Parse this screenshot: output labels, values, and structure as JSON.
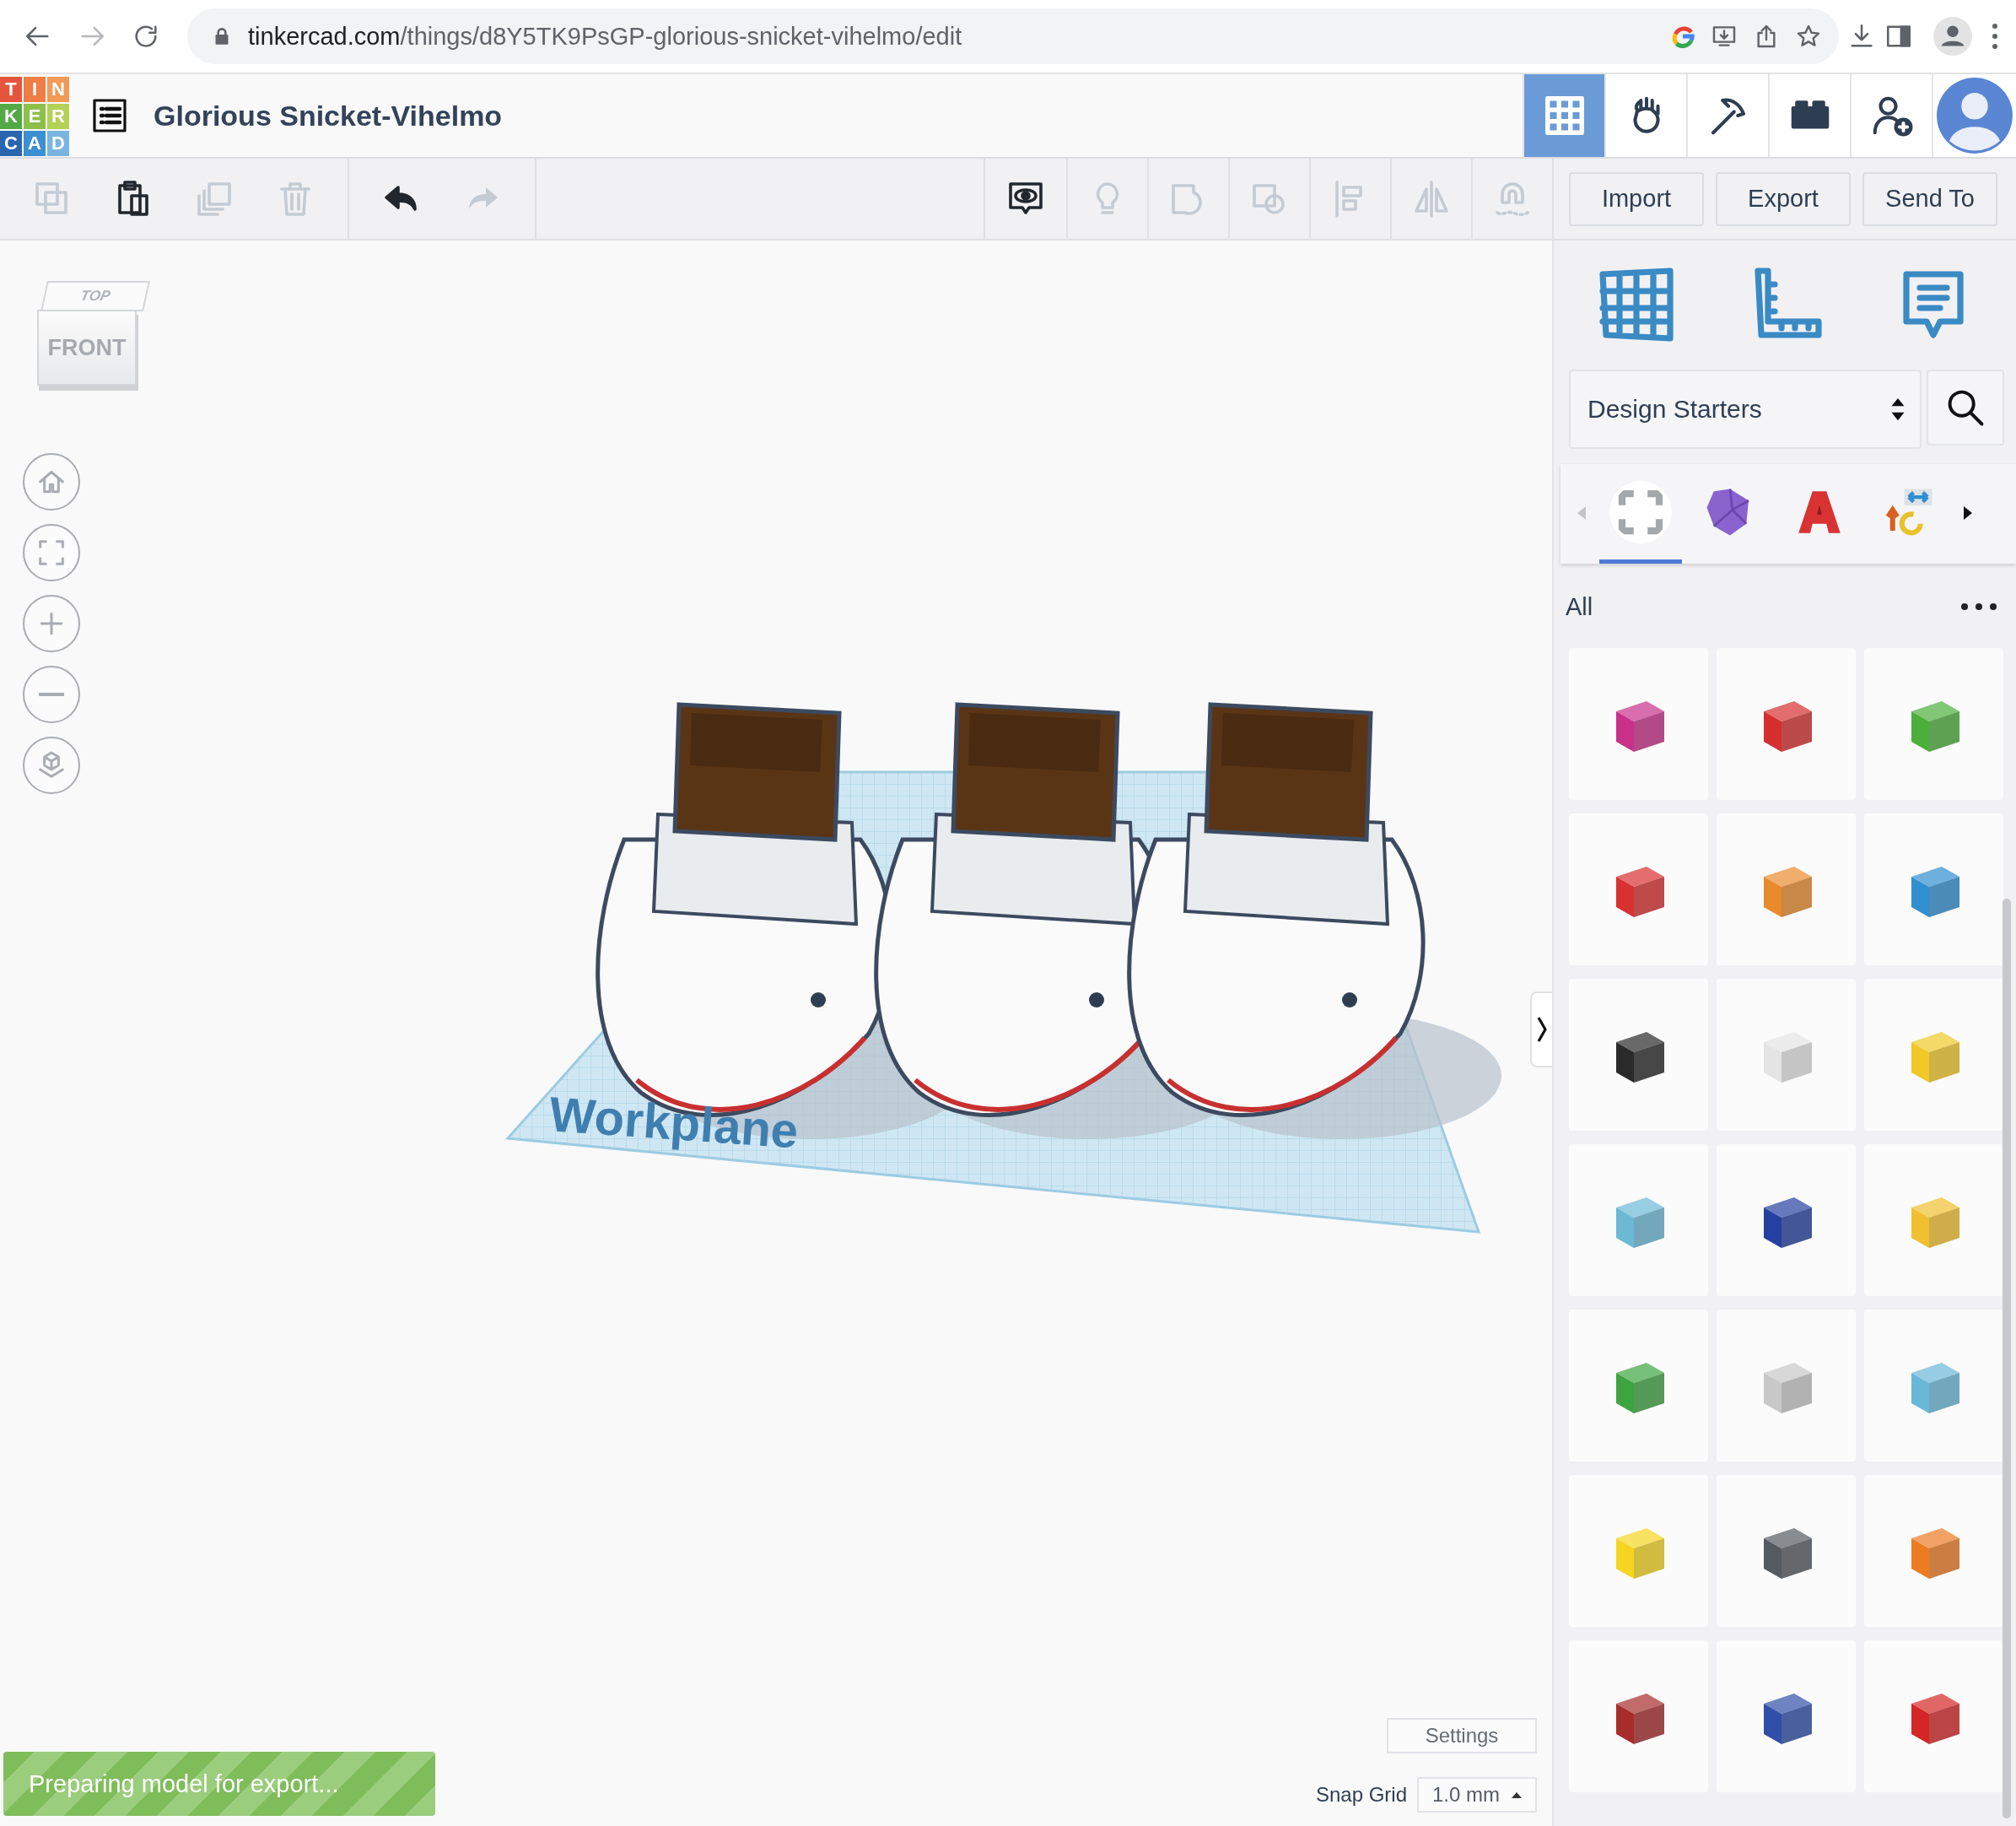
{
  "browser": {
    "url_host": "tinkercad.com",
    "url_path": "/things/d8Y5TK9PsGP-glorious-snicket-vihelmo/edit"
  },
  "header": {
    "logo": [
      {
        "letter": "T",
        "color": "#e5553d"
      },
      {
        "letter": "I",
        "color": "#ef7d45"
      },
      {
        "letter": "N",
        "color": "#f29a57"
      },
      {
        "letter": "K",
        "color": "#53a945"
      },
      {
        "letter": "E",
        "color": "#8cc04a"
      },
      {
        "letter": "R",
        "color": "#b2d155"
      },
      {
        "letter": "C",
        "color": "#2a66b0"
      },
      {
        "letter": "A",
        "color": "#3c8fd0"
      },
      {
        "letter": "D",
        "color": "#79b5e2"
      }
    ],
    "title": "Glorious Snicket-Vihelmo",
    "views": [
      {
        "kind": "grid",
        "selected": true
      },
      {
        "kind": "hand",
        "selected": false
      },
      {
        "kind": "pickaxe",
        "selected": false
      },
      {
        "kind": "brick",
        "selected": false
      },
      {
        "kind": "adduser",
        "selected": false
      }
    ]
  },
  "toolbar": {
    "edit_tools": [
      {
        "kind": "copy",
        "disabled": true
      },
      {
        "kind": "paste",
        "disabled": false
      },
      {
        "kind": "duplicate",
        "disabled": true
      },
      {
        "kind": "trash",
        "disabled": true
      }
    ],
    "history_tools": [
      {
        "kind": "undo",
        "disabled": false
      },
      {
        "kind": "redo",
        "disabled": true
      }
    ],
    "view_tools": [
      {
        "kind": "notes",
        "disabled": false
      },
      {
        "kind": "bulb",
        "disabled": true
      },
      {
        "kind": "group",
        "disabled": true
      },
      {
        "kind": "ungroup",
        "disabled": true
      },
      {
        "kind": "align",
        "disabled": true
      },
      {
        "kind": "mirror",
        "disabled": true
      },
      {
        "kind": "magnet",
        "disabled": true
      }
    ],
    "buttons": [
      "Import",
      "Export",
      "Send To"
    ]
  },
  "view_cube": {
    "top": "TOP",
    "front": "FRONT"
  },
  "nav_controls": [
    {
      "kind": "home"
    },
    {
      "kind": "fit"
    },
    {
      "kind": "zoomin"
    },
    {
      "kind": "zoomout"
    },
    {
      "kind": "ortho"
    }
  ],
  "workplane": {
    "label": "Workplane"
  },
  "panel": {
    "modes": [
      {
        "kind": "workplane"
      },
      {
        "kind": "ruler"
      },
      {
        "kind": "notes"
      }
    ],
    "library": {
      "value": "Design Starters"
    },
    "categories": [
      {
        "kind": "frame",
        "selected": true
      },
      {
        "kind": "gem",
        "selected": false
      },
      {
        "kind": "letter",
        "selected": false
      },
      {
        "kind": "transform",
        "selected": false
      }
    ],
    "filter": "All",
    "shapes": [
      {
        "color": "#c8308a"
      },
      {
        "color": "#d62f2f"
      },
      {
        "color": "#4caf3c"
      },
      {
        "color": "#d93030"
      },
      {
        "color": "#e98a2c"
      },
      {
        "color": "#2f8fd0"
      },
      {
        "color": "#2a2a2a"
      },
      {
        "color": "#e4e4e4"
      },
      {
        "color": "#f0c828"
      },
      {
        "color": "#6cb9d6"
      },
      {
        "color": "#2440a0"
      },
      {
        "color": "#f0c030"
      },
      {
        "color": "#3da540"
      },
      {
        "color": "#c8c8c8"
      },
      {
        "color": "#6ab8d8"
      },
      {
        "color": "#f5d520"
      },
      {
        "color": "#555a60"
      },
      {
        "color": "#ec7b22"
      },
      {
        "color": "#a82c2c"
      },
      {
        "color": "#2f4fa8"
      },
      {
        "color": "#d42626"
      }
    ]
  },
  "settings": "Settings",
  "snap_grid": {
    "label": "Snap Grid",
    "value": "1.0 mm"
  },
  "status": {
    "message": "Preparing model for export..."
  }
}
